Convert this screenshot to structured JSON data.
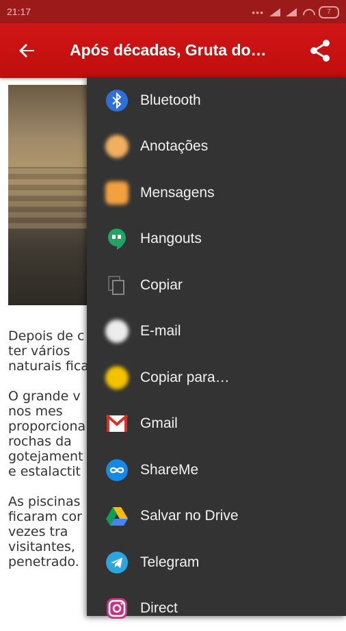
{
  "status": {
    "time": "21:17",
    "battery": "7"
  },
  "appbar": {
    "title": "Após décadas, Gruta do…"
  },
  "article": {
    "paragraphs": [
      "Depois de c\nter vários\nnaturais fica",
      "O grande v\nnos mes\nproporciona\nrochas da\ngotejament\ne estalactit",
      "As piscinas\nficaram cor\nvezes tra\nvisitantes,\npenetrado."
    ]
  },
  "share_menu": {
    "items": [
      {
        "label": "Bluetooth",
        "icon": "bluetooth-icon"
      },
      {
        "label": "Anotações",
        "icon": "notes-icon"
      },
      {
        "label": "Mensagens",
        "icon": "messages-icon"
      },
      {
        "label": "Hangouts",
        "icon": "hangouts-icon"
      },
      {
        "label": "Copiar",
        "icon": "copy-icon"
      },
      {
        "label": "E-mail",
        "icon": "email-icon"
      },
      {
        "label": "Copiar para…",
        "icon": "copy-to-icon"
      },
      {
        "label": "Gmail",
        "icon": "gmail-icon"
      },
      {
        "label": "ShareMe",
        "icon": "shareme-icon"
      },
      {
        "label": "Salvar no Drive",
        "icon": "drive-icon"
      },
      {
        "label": "Telegram",
        "icon": "telegram-icon"
      },
      {
        "label": "Direct",
        "icon": "instagram-direct-icon"
      }
    ]
  },
  "colors": {
    "appbar": "#c80f0f",
    "statusbar": "#9c1a1a",
    "sheet": "#333333"
  }
}
